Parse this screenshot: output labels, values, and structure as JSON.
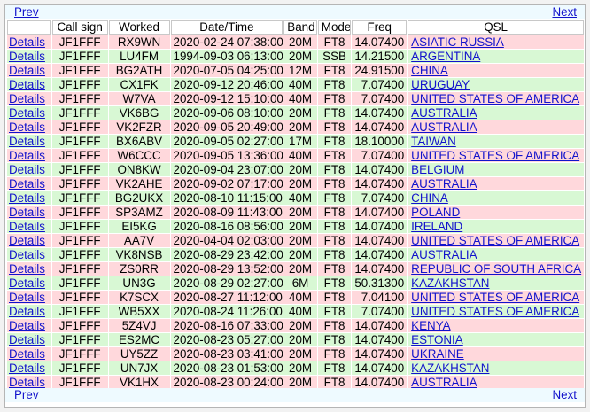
{
  "nav": {
    "prev_label": "Prev",
    "next_label": "Next"
  },
  "columns": [
    "",
    "Call sign",
    "Worked",
    "Date/Time",
    "Band",
    "Mode",
    "Freq",
    "QSL"
  ],
  "row_colors": {
    "pink": "#ffd8dc",
    "green": "#d8f8d4",
    "link": "#1212cc"
  },
  "rows": [
    {
      "details": "Details",
      "callsign": "JF1FFF",
      "worked": "RX9WN",
      "datetime": "2020-02-24 07:38:00",
      "band": "20M",
      "mode": "FT8",
      "freq": "14.07400",
      "qsl": "ASIATIC RUSSIA",
      "color": "pink"
    },
    {
      "details": "Details",
      "callsign": "JF1FFF",
      "worked": "LU4FM",
      "datetime": "1994-09-03 06:13:00",
      "band": "20M",
      "mode": "SSB",
      "freq": "14.21500",
      "qsl": "ARGENTINA",
      "color": "green"
    },
    {
      "details": "Details",
      "callsign": "JF1FFF",
      "worked": "BG2ATH",
      "datetime": "2020-07-05 04:25:00",
      "band": "12M",
      "mode": "FT8",
      "freq": "24.91500",
      "qsl": "CHINA",
      "color": "pink"
    },
    {
      "details": "Details",
      "callsign": "JF1FFF",
      "worked": "CX1FK",
      "datetime": "2020-09-12 20:46:00",
      "band": "40M",
      "mode": "FT8",
      "freq": "7.07400",
      "qsl": "URUGUAY",
      "color": "green"
    },
    {
      "details": "Details",
      "callsign": "JF1FFF",
      "worked": "W7VA",
      "datetime": "2020-09-12 15:10:00",
      "band": "40M",
      "mode": "FT8",
      "freq": "7.07400",
      "qsl": "UNITED STATES OF AMERICA",
      "color": "pink"
    },
    {
      "details": "Details",
      "callsign": "JF1FFF",
      "worked": "VK6BG",
      "datetime": "2020-09-06 08:10:00",
      "band": "20M",
      "mode": "FT8",
      "freq": "14.07400",
      "qsl": "AUSTRALIA",
      "color": "green"
    },
    {
      "details": "Details",
      "callsign": "JF1FFF",
      "worked": "VK2FZR",
      "datetime": "2020-09-05 20:49:00",
      "band": "20M",
      "mode": "FT8",
      "freq": "14.07400",
      "qsl": "AUSTRALIA",
      "color": "pink"
    },
    {
      "details": "Details",
      "callsign": "JF1FFF",
      "worked": "BX6ABV",
      "datetime": "2020-09-05 02:27:00",
      "band": "17M",
      "mode": "FT8",
      "freq": "18.10000",
      "qsl": "TAIWAN",
      "color": "green"
    },
    {
      "details": "Details",
      "callsign": "JF1FFF",
      "worked": "W6CCC",
      "datetime": "2020-09-05 13:36:00",
      "band": "40M",
      "mode": "FT8",
      "freq": "7.07400",
      "qsl": "UNITED STATES OF AMERICA",
      "color": "pink"
    },
    {
      "details": "Details",
      "callsign": "JF1FFF",
      "worked": "ON8KW",
      "datetime": "2020-09-04 23:07:00",
      "band": "20M",
      "mode": "FT8",
      "freq": "14.07400",
      "qsl": "BELGIUM",
      "color": "green"
    },
    {
      "details": "Details",
      "callsign": "JF1FFF",
      "worked": "VK2AHE",
      "datetime": "2020-09-02 07:17:00",
      "band": "20M",
      "mode": "FT8",
      "freq": "14.07400",
      "qsl": "AUSTRALIA",
      "color": "pink"
    },
    {
      "details": "Details",
      "callsign": "JF1FFF",
      "worked": "BG2UKX",
      "datetime": "2020-08-10 11:15:00",
      "band": "40M",
      "mode": "FT8",
      "freq": "7.07400",
      "qsl": "CHINA",
      "color": "green"
    },
    {
      "details": "Details",
      "callsign": "JF1FFF",
      "worked": "SP3AMZ",
      "datetime": "2020-08-09 11:43:00",
      "band": "20M",
      "mode": "FT8",
      "freq": "14.07400",
      "qsl": "POLAND",
      "color": "pink"
    },
    {
      "details": "Details",
      "callsign": "JF1FFF",
      "worked": "EI5KG",
      "datetime": "2020-08-16 08:56:00",
      "band": "20M",
      "mode": "FT8",
      "freq": "14.07400",
      "qsl": "IRELAND",
      "color": "green"
    },
    {
      "details": "Details",
      "callsign": "JF1FFF",
      "worked": "AA7V",
      "datetime": "2020-04-04 02:03:00",
      "band": "20M",
      "mode": "FT8",
      "freq": "14.07400",
      "qsl": "UNITED STATES OF AMERICA",
      "color": "pink"
    },
    {
      "details": "Details",
      "callsign": "JF1FFF",
      "worked": "VK8NSB",
      "datetime": "2020-08-29 23:42:00",
      "band": "20M",
      "mode": "FT8",
      "freq": "14.07400",
      "qsl": "AUSTRALIA",
      "color": "green"
    },
    {
      "details": "Details",
      "callsign": "JF1FFF",
      "worked": "ZS0RR",
      "datetime": "2020-08-29 13:52:00",
      "band": "20M",
      "mode": "FT8",
      "freq": "14.07400",
      "qsl": "REPUBLIC OF SOUTH AFRICA",
      "color": "pink"
    },
    {
      "details": "Details",
      "callsign": "JF1FFF",
      "worked": "UN3G",
      "datetime": "2020-08-29 02:27:00",
      "band": "6M",
      "mode": "FT8",
      "freq": "50.31300",
      "qsl": "KAZAKHSTAN",
      "color": "green"
    },
    {
      "details": "Details",
      "callsign": "JF1FFF",
      "worked": "K7SCX",
      "datetime": "2020-08-27 11:12:00",
      "band": "40M",
      "mode": "FT8",
      "freq": "7.04100",
      "qsl": "UNITED STATES OF AMERICA",
      "color": "pink"
    },
    {
      "details": "Details",
      "callsign": "JF1FFF",
      "worked": "WB5XX",
      "datetime": "2020-08-24 11:26:00",
      "band": "40M",
      "mode": "FT8",
      "freq": "7.07400",
      "qsl": "UNITED STATES OF AMERICA",
      "color": "green"
    },
    {
      "details": "Details",
      "callsign": "JF1FFF",
      "worked": "5Z4VJ",
      "datetime": "2020-08-16 07:33:00",
      "band": "20M",
      "mode": "FT8",
      "freq": "14.07400",
      "qsl": "KENYA",
      "color": "pink"
    },
    {
      "details": "Details",
      "callsign": "JF1FFF",
      "worked": "ES2MC",
      "datetime": "2020-08-23 05:27:00",
      "band": "20M",
      "mode": "FT8",
      "freq": "14.07400",
      "qsl": "ESTONIA",
      "color": "green"
    },
    {
      "details": "Details",
      "callsign": "JF1FFF",
      "worked": "UY5ZZ",
      "datetime": "2020-08-23 03:41:00",
      "band": "20M",
      "mode": "FT8",
      "freq": "14.07400",
      "qsl": "UKRAINE",
      "color": "pink"
    },
    {
      "details": "Details",
      "callsign": "JF1FFF",
      "worked": "UN7JX",
      "datetime": "2020-08-23 01:53:00",
      "band": "20M",
      "mode": "FT8",
      "freq": "14.07400",
      "qsl": "KAZAKHSTAN",
      "color": "green"
    },
    {
      "details": "Details",
      "callsign": "JF1FFF",
      "worked": "VK1HX",
      "datetime": "2020-08-23 00:24:00",
      "band": "20M",
      "mode": "FT8",
      "freq": "14.07400",
      "qsl": "AUSTRALIA",
      "color": "pink"
    }
  ]
}
